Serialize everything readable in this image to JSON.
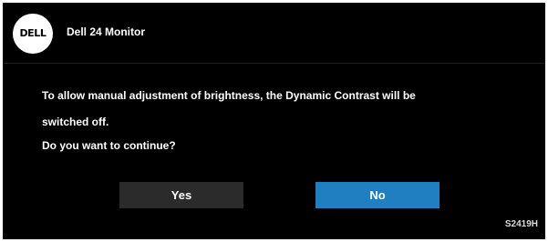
{
  "header": {
    "logo_text": "DELL",
    "title": "Dell 24 Monitor"
  },
  "dialog": {
    "message_line1": "To allow manual adjustment of brightness, the Dynamic Contrast will be",
    "message_line2": "switched off.",
    "question": "Do you want to continue?"
  },
  "buttons": {
    "yes_label": "Yes",
    "no_label": "No"
  },
  "footer": {
    "model": "S2419H"
  },
  "colors": {
    "background": "#000000",
    "selected_button": "#1f7fc1",
    "unselected_button": "#2b2b2b",
    "text": "#ffffff"
  }
}
